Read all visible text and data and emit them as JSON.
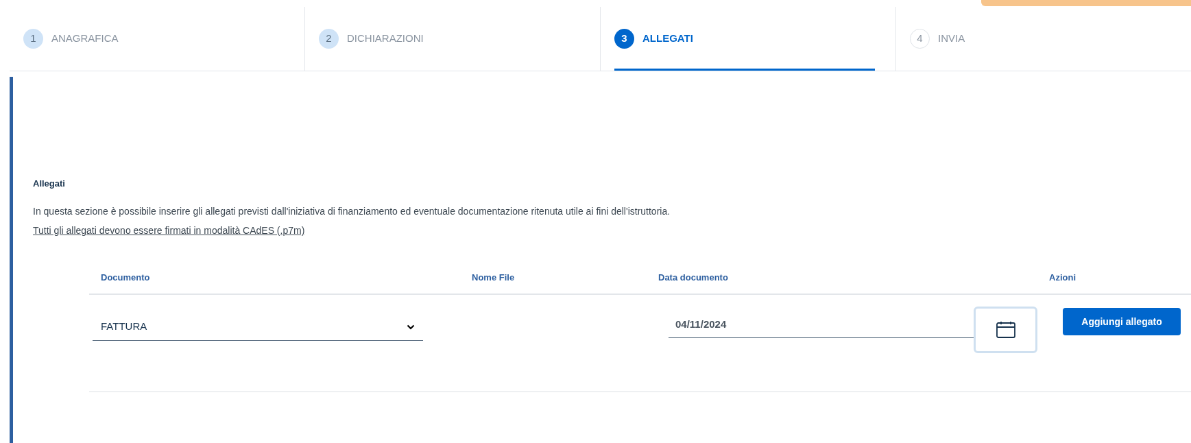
{
  "steps": [
    {
      "number": "1",
      "label": "ANAGRAFICA",
      "kind": "visited",
      "selected": false
    },
    {
      "number": "2",
      "label": "DICHIARAZIONI",
      "kind": "visited",
      "selected": false
    },
    {
      "number": "3",
      "label": "ALLEGATI",
      "kind": "current",
      "selected": true
    },
    {
      "number": "4",
      "label": "INVIA",
      "kind": "todo",
      "selected": false
    }
  ],
  "section": {
    "title": "Allegati",
    "description": "In questa sezione è possibile inserire gli allegati previsti dall'iniziativa di finanziamento ed eventuale documentazione ritenuta utile ai fini dell'istruttoria.",
    "link": "Tutti gli allegati devono essere firmati in modalità CAdES (.p7m)"
  },
  "table": {
    "columns": [
      "Documento",
      "Nome File",
      "Data documento",
      "Azioni"
    ],
    "row": {
      "document": "FATTURA",
      "date": "04/11/2024",
      "action": "Aggiungi allegato"
    }
  }
}
